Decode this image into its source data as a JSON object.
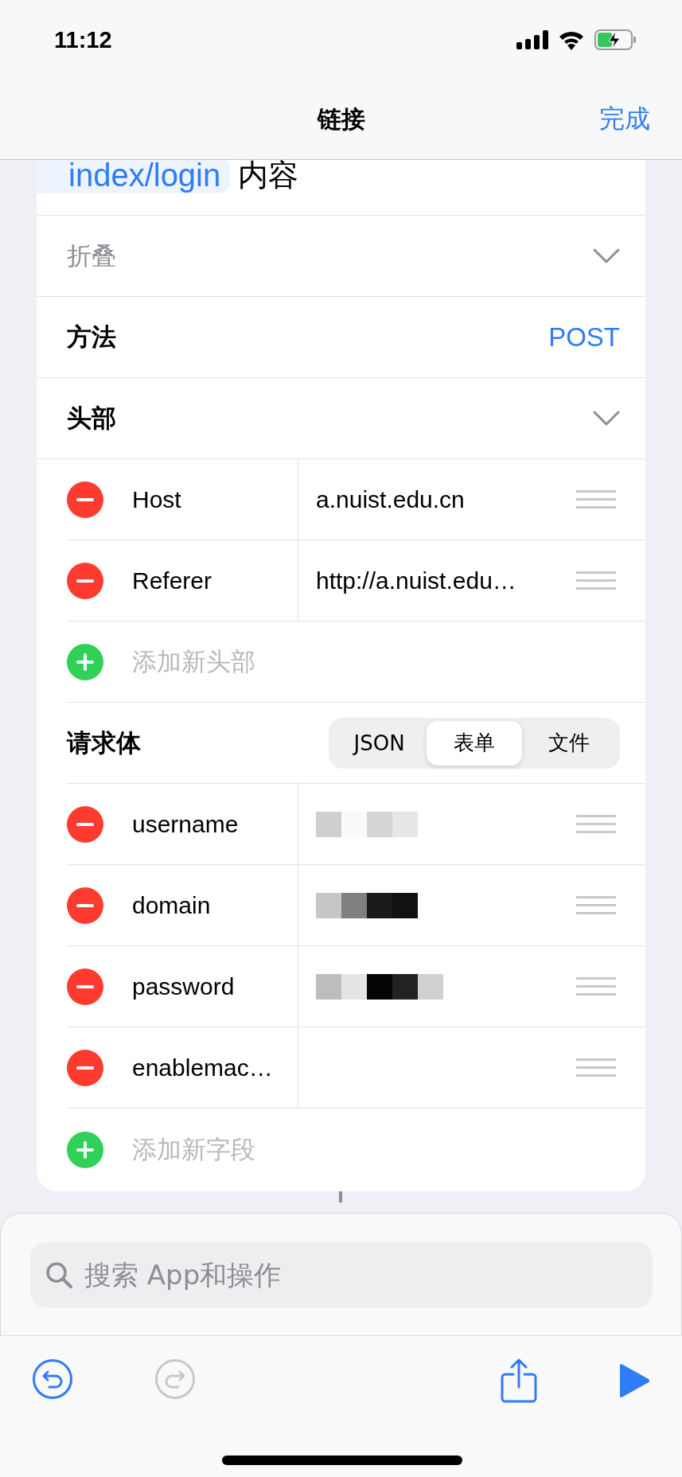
{
  "status_bar": {
    "time": "11:12"
  },
  "nav": {
    "title": "链接",
    "done": "完成"
  },
  "url_row": {
    "token": "index/login",
    "text": "内容"
  },
  "rows": [
    {
      "kind": "expander",
      "label": "折叠",
      "muted": true
    },
    {
      "kind": "value",
      "label": "方法",
      "value": "POST"
    },
    {
      "kind": "expander",
      "label": "头部",
      "muted": false
    }
  ],
  "headers": [
    {
      "key": "Host",
      "value": "a.nuist.edu.cn"
    },
    {
      "key": "Referer",
      "value": "http://a.nuist.edu…"
    }
  ],
  "add_header": "添加新头部",
  "body": {
    "label": "请求体",
    "segments": [
      {
        "label": "JSON",
        "selected": false
      },
      {
        "label": "表单",
        "selected": true
      },
      {
        "label": "文件",
        "selected": false
      }
    ]
  },
  "fields": [
    {
      "key": "username",
      "kind": "redacted"
    },
    {
      "key": "domain",
      "kind": "redacted"
    },
    {
      "key": "password",
      "kind": "redacted"
    },
    {
      "key": "enablemac…",
      "kind": "empty"
    }
  ],
  "add_field": "添加新字段",
  "search": {
    "placeholder": "搜索 App和操作"
  },
  "toolbar": [
    {
      "kind": "undo",
      "disabled": false
    },
    {
      "kind": "redo",
      "disabled": true
    },
    {
      "kind": "share",
      "disabled": false
    },
    {
      "kind": "play",
      "disabled": false
    }
  ]
}
